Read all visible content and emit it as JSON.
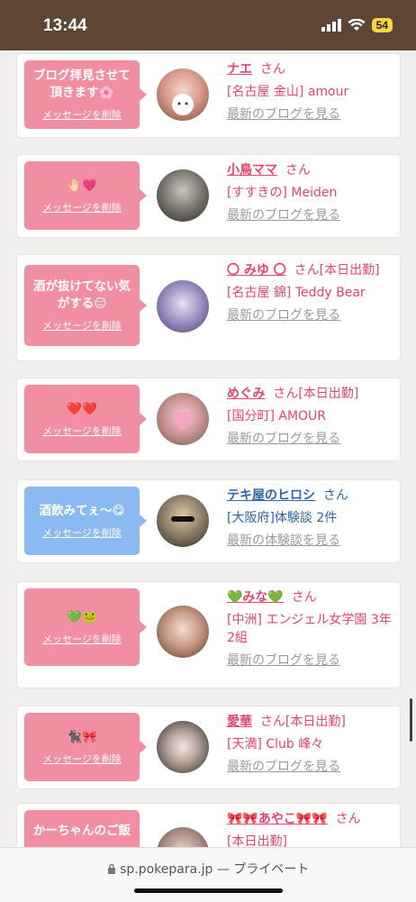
{
  "status": {
    "time": "13:44",
    "battery": "54"
  },
  "cards": [
    {
      "message": "ブログ拝見させて頂きます🌸",
      "delete": "メッセージを削除",
      "name": "ナエ",
      "suffix": "さん",
      "shop": "[名古屋 金山] amour",
      "link": "最新のブログを見る",
      "color": "pink"
    },
    {
      "message": "🤚🏻💗",
      "delete": "メッセージを削除",
      "name": "小鳥ママ",
      "suffix": "さん",
      "shop": "[すすきの] Meiden",
      "link": "最新のブログを見る",
      "color": "pink"
    },
    {
      "message": "酒が抜けてない気がする😑",
      "delete": "メッセージを削除",
      "name": "〇 みゆ 〇",
      "suffix": "さん[本日出勤]",
      "shop": "[名古屋 錦] Teddy Bear",
      "link": "最新のブログを見る",
      "color": "pink"
    },
    {
      "message": "❤️❤️",
      "delete": "メッセージを削除",
      "name": "めぐみ",
      "suffix": "さん[本日出勤]",
      "shop": "[国分町] AMOUR",
      "link": "最新のブログを見る",
      "color": "pink"
    },
    {
      "message": "酒飲みてぇ〜😋",
      "delete": "メッセージを削除",
      "name": "テキ屋のヒロシ",
      "suffix": "さん",
      "shop": "[大阪府]体験談 2件",
      "link": "最新の体験談を見る",
      "color": "blue"
    },
    {
      "message": "💚🐸",
      "delete": "メッセージを削除",
      "name": "💚みな💚",
      "suffix": "さん",
      "shop": "[中洲] エンジェル女学園 3年2組",
      "link": "最新のブログを見る",
      "color": "pink"
    },
    {
      "message": "🐈‍⬛🎀",
      "delete": "メッセージを削除",
      "name": "愛華",
      "suffix": "さん[本日出勤]",
      "shop": "[天満] Club 峰々",
      "link": "最新のブログを見る",
      "color": "pink"
    },
    {
      "message": "かーちゃんのご飯",
      "delete": "",
      "name": "🎀🎀あやこ🎀🎀",
      "suffix": "さん",
      "shop": "[本日出勤]",
      "link": "",
      "color": "pink"
    }
  ],
  "urlbar": {
    "domain": "sp.pokepara.jp",
    "separator": "—",
    "mode": "プライベート"
  },
  "colors": {
    "pink": "#f28ea2",
    "blue": "#8bb9f2",
    "header": "#5e4634"
  }
}
